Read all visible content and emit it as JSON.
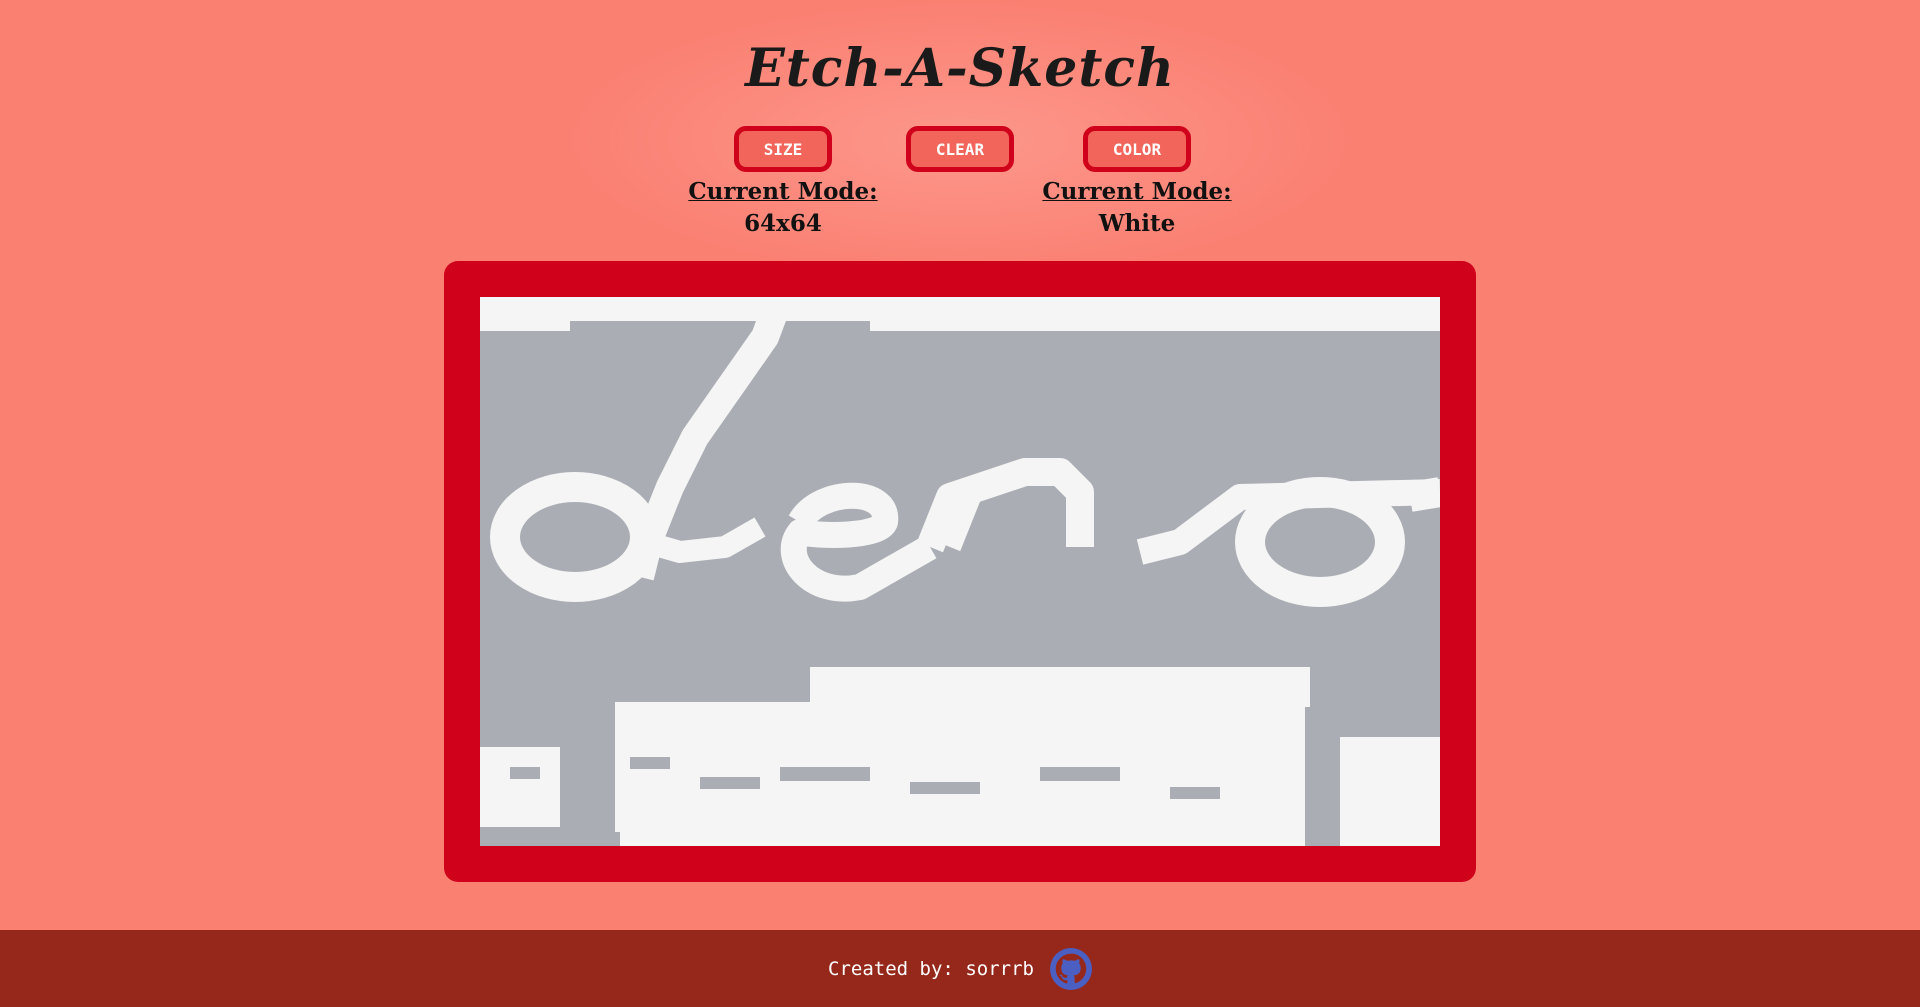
{
  "app": {
    "title": "Etch-A-Sketch"
  },
  "controls": {
    "size_label": "SIZE",
    "clear_label": "CLEAR",
    "color_label": "COLOR"
  },
  "size_mode": {
    "label": "Current Mode:",
    "value": "64x64"
  },
  "color_mode": {
    "label": "Current Mode:",
    "value": "White"
  },
  "board": {
    "grid": "64x64",
    "paint_color": "#f5f5f5",
    "empty_color": "#aaaeb4"
  },
  "footer": {
    "credit": "Created by: sorrrb",
    "icon": "github-icon"
  },
  "colors": {
    "background": "#fa8072",
    "frame": "#d0021b",
    "footer": "#96281b",
    "github": "#4a5fc1"
  }
}
